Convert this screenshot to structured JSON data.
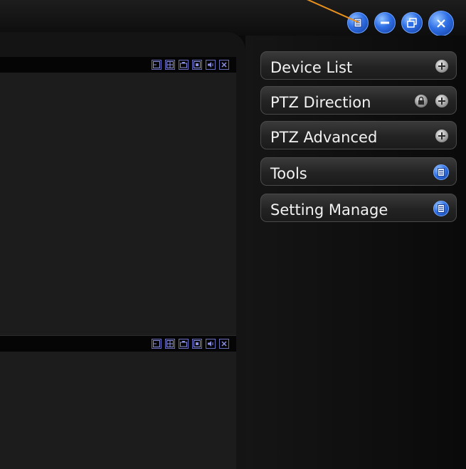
{
  "window": {
    "controls": [
      {
        "name": "menu-list-icon"
      },
      {
        "name": "minimize-icon"
      },
      {
        "name": "restore-icon"
      },
      {
        "name": "close-icon"
      }
    ]
  },
  "colors": {
    "annotation_line": "#e8901e",
    "button_blue": "#2f6fe6",
    "panel_text": "#f2f2f2"
  },
  "right_panel": {
    "items": [
      {
        "label": "Device List",
        "icon": "plus-icon"
      },
      {
        "label": "PTZ Direction",
        "icon": "plus-icon",
        "extra_icon": "lock-icon"
      },
      {
        "label": "PTZ Advanced",
        "icon": "plus-icon"
      },
      {
        "label": "Tools",
        "icon": "list-icon"
      },
      {
        "label": "Setting Manage",
        "icon": "list-icon"
      }
    ]
  },
  "video_panes": [
    {
      "toolbar_icons": [
        "single-view-icon",
        "quad-view-icon",
        "snapshot-icon",
        "record-icon",
        "audio-icon",
        "close-pane-icon"
      ]
    },
    {
      "toolbar_icons": [
        "single-view-icon",
        "quad-view-icon",
        "snapshot-icon",
        "record-icon",
        "audio-icon",
        "close-pane-icon"
      ]
    }
  ]
}
